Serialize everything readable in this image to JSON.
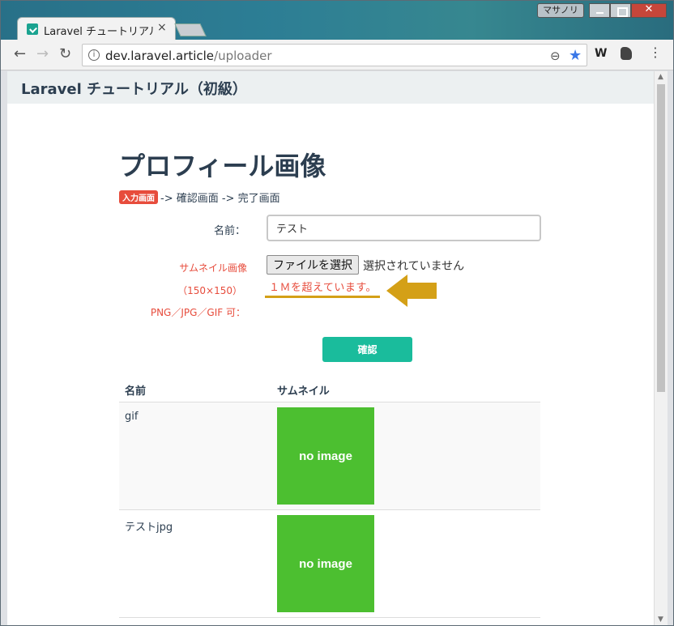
{
  "browser": {
    "tab_title": "Laravel チュートリアル",
    "tab_close": "×",
    "window_user": "マサノリ",
    "window_close": "✕",
    "url_host": "dev.laravel.article",
    "url_path": "/uploader",
    "extension_w": "W"
  },
  "site": {
    "brand": "Laravel チュートリアル（初級）"
  },
  "page": {
    "title": "プロフィール画像",
    "step_current": "入力画面",
    "steps_rest": "-> 確認画面 -> 完了画面"
  },
  "form": {
    "name_label": "名前：",
    "name_value": "テスト",
    "thumb_label_1": "サムネイル画像",
    "thumb_label_2": "（150×150）",
    "thumb_label_3": "PNG／JPG／GIF 可：",
    "file_button": "ファイルを選択",
    "file_status": "選択されていません",
    "error_message": "１Ｍを超えています。",
    "submit": "確認"
  },
  "table": {
    "headers": [
      "名前",
      "サムネイル"
    ],
    "rows": [
      {
        "name": "gif",
        "thumb_text": "no image"
      },
      {
        "name": "テストjpg",
        "thumb_text": "no image"
      }
    ]
  },
  "colors": {
    "accent": "#1abc9c",
    "error": "#e74c3c",
    "highlight": "#d4a017",
    "placeholder_green": "#4cbf30"
  }
}
